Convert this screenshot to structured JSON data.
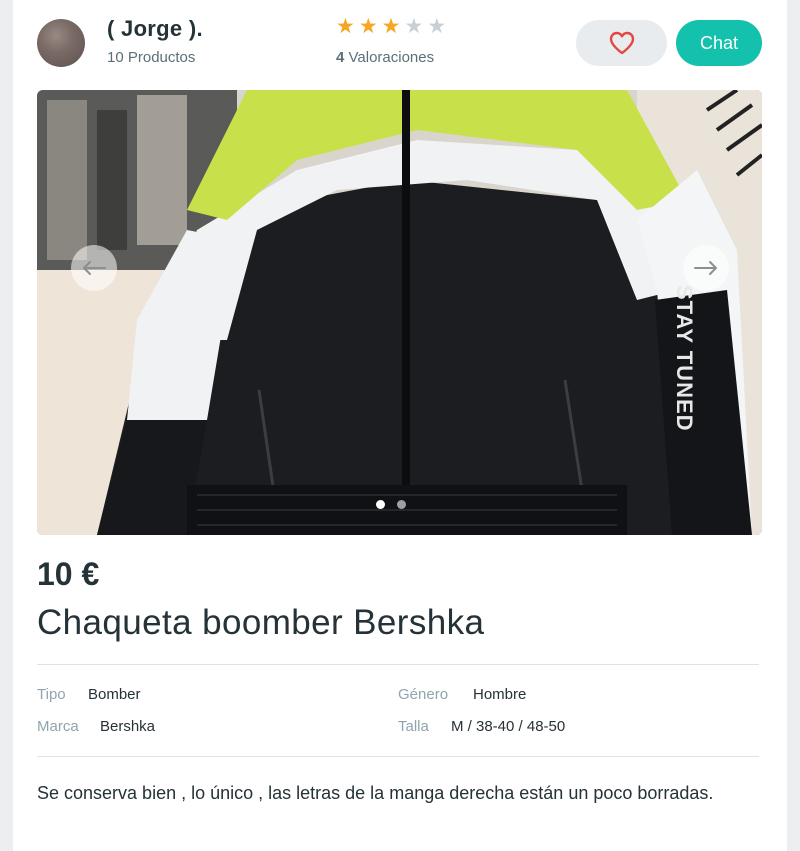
{
  "seller": {
    "name": "( Jorge ).",
    "products": "10 Productos"
  },
  "rating": {
    "stars_filled": 3,
    "stars_total": 5,
    "count": "4",
    "label": "Valoraciones"
  },
  "actions": {
    "favorite_icon": "heart-icon",
    "chat_label": "Chat"
  },
  "gallery": {
    "current_slide": 1,
    "total_slides": 2
  },
  "product": {
    "price": "10 €",
    "title": "Chaqueta boomber Bershka",
    "sleeve_text": "STAY TUNED"
  },
  "attributes": {
    "tipo_label": "Tipo",
    "tipo_value": "Bomber",
    "genero_label": "Género",
    "genero_value": "Hombre",
    "marca_label": "Marca",
    "marca_value": "Bershka",
    "talla_label": "Talla",
    "talla_value": "M / 38-40 / 48-50"
  },
  "description": "Se conserva bien , lo único , las letras de la manga derecha están un poco borradas.",
  "colors": {
    "accent": "#13c1ac",
    "heart": "#e4473f",
    "star_on": "#f5a623",
    "star_off": "#c7d0d6"
  }
}
